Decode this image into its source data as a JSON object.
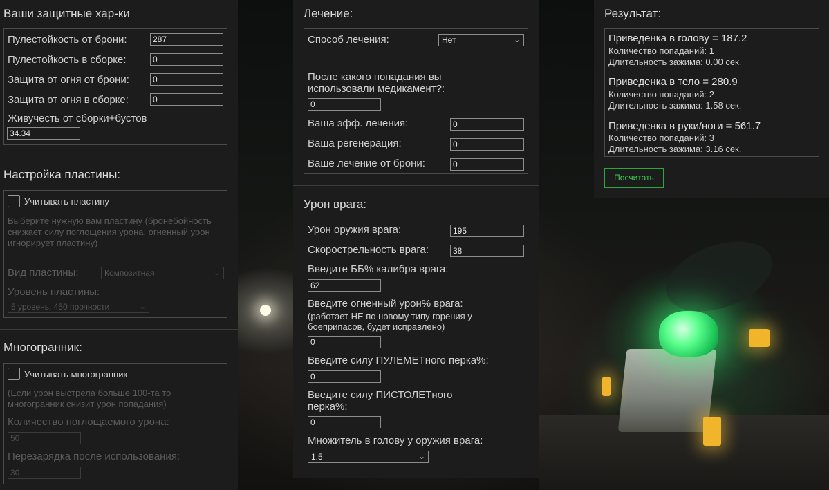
{
  "defense": {
    "title": "Ваши защитные хар-ки",
    "fields": [
      {
        "label": "Пулестойкость от брони:",
        "value": "287"
      },
      {
        "label": "Пулестойкость в сборке:",
        "value": "0"
      },
      {
        "label": "Защита от огня от брони:",
        "value": "0"
      },
      {
        "label": "Защита от огня в сборке:",
        "value": "0"
      }
    ],
    "vitality_label": "Живучесть от сборки+бустов",
    "vitality_value": "34.34"
  },
  "plate": {
    "title": "Настройка пластины:",
    "checkbox_label": "Учитывать пластину",
    "hint": "Выберите нужную вам пластину (бронебойность снижает силу поглощения урона, огненный урон игнорирует пластину)",
    "type_label": "Вид пластины:",
    "type_value": "Композитная",
    "level_label": "Уровень пластины:",
    "level_value": "5 уровень, 450 прочности"
  },
  "polyhedron": {
    "title": "Многогранник:",
    "checkbox_label": "Учитывать многогранник",
    "hint": "(Если урон выстрела больше 100-та то многогранник снизит урон попадания)",
    "absorb_label": "Количество поглощаемого урона:",
    "absorb_value": "50",
    "cooldown_label": "Перезарядка после использования:",
    "cooldown_value": "30"
  },
  "healing": {
    "title": "Лечение:",
    "method_label": "Способ лечения:",
    "method_value": "Нет",
    "after_hit_label": "После какого попадания вы использовали медикамент?:",
    "after_hit_value": "0",
    "eff_label": "Ваша эфф. лечения:",
    "eff_value": "0",
    "regen_label": "Ваша регенерация:",
    "regen_value": "0",
    "armor_heal_label": "Ваше лечение от брони:",
    "armor_heal_value": "0"
  },
  "enemy": {
    "title": "Урон врага:",
    "damage_label": "Урон оружия врага:",
    "damage_value": "195",
    "rof_label": "Скорострельность врага:",
    "rof_value": "38",
    "pen_label": "Введите ББ% калибра врага:",
    "pen_value": "62",
    "fire_label": "Введите огненный урон% врага:",
    "fire_note": "(работает НЕ по новому типу горения у боеприпасов, будет исправлено)",
    "fire_value": "0",
    "mg_label": "Введите силу ПУЛЕМЕТного перка%:",
    "mg_value": "0",
    "pistol_label": "Введите силу ПИСТОЛЕТного перка%:",
    "pistol_value": "0",
    "head_mult_label": "Множитель в голову у оружия врага:",
    "head_mult_value": "1.5"
  },
  "result": {
    "title": "Результат:",
    "blocks": [
      {
        "title": "Приведенка в голову = 187.2",
        "hits": "Количество попаданий: 1",
        "ttk": "Длительность зажима: 0.00 сек."
      },
      {
        "title": "Приведенка в тело = 280.9",
        "hits": "Количество попаданий: 2",
        "ttk": "Длительность зажима: 1.58 сек."
      },
      {
        "title": "Приведенка в руки/ноги = 561.7",
        "hits": "Количество попаданий: 3",
        "ttk": "Длительность зажима: 3.16 сек."
      }
    ],
    "calc_button": "Посчитать"
  }
}
